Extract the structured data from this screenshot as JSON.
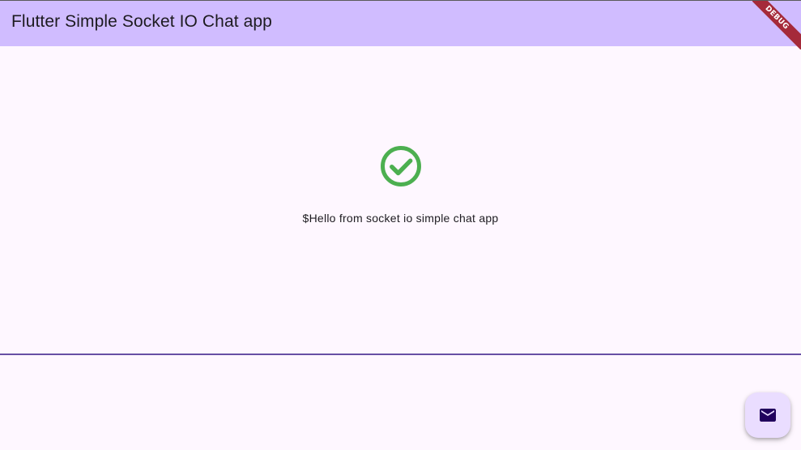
{
  "appbar": {
    "title": "Flutter Simple Socket IO Chat app",
    "debug_label": "DEBUG",
    "background": "#d0bcff"
  },
  "status": {
    "icon": "check-circle-icon",
    "icon_color": "#4caf50",
    "message": "$Hello from socket io simple chat app"
  },
  "input": {
    "value": "",
    "underline_color": "#6750a4"
  },
  "fab": {
    "icon": "mail-icon",
    "background": "#eaddff",
    "icon_color": "#21005d"
  }
}
